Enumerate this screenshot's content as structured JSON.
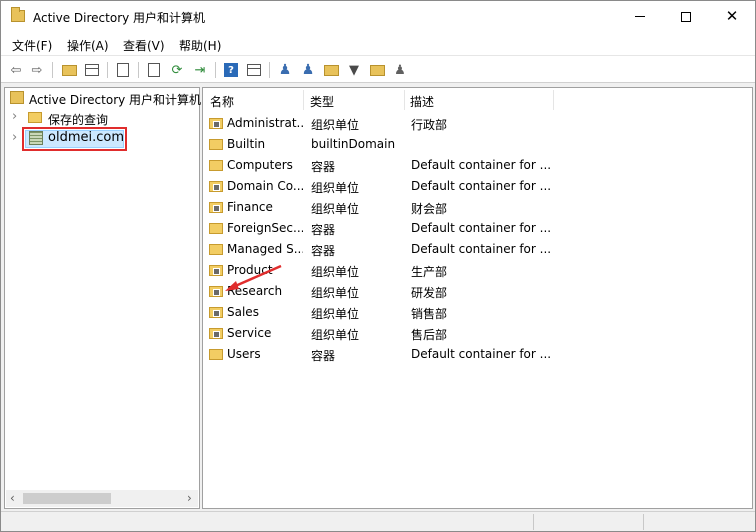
{
  "window": {
    "title": "Active Directory 用户和计算机",
    "controls": {
      "minimize": "minimize",
      "maximize": "maximize",
      "close": "✕"
    }
  },
  "menu": [
    "文件(F)",
    "操作(A)",
    "查看(V)",
    "帮助(H)"
  ],
  "toolbar": {
    "icons": [
      "back-arrow-icon",
      "forward-arrow-icon",
      "up-folder-icon",
      "show-tree-icon",
      "properties-icon",
      "export-list-icon",
      "refresh-icon",
      "export-icon",
      "help-icon",
      "view-icon",
      "new-user-icon",
      "new-group-icon",
      "new-ou-icon",
      "filter-icon",
      "find-icon",
      "delegate-icon"
    ],
    "help_label": "?"
  },
  "tree": {
    "root_label": "Active Directory 用户和计算机",
    "saved_queries_label": "保存的查询",
    "domain_label": "oldmei.com"
  },
  "list": {
    "columns": [
      "名称",
      "类型",
      "描述"
    ],
    "rows": [
      {
        "name": "Administrat...",
        "type": "组织单位",
        "desc": "行政部",
        "icon": "ou"
      },
      {
        "name": "Builtin",
        "type": "builtinDomain",
        "desc": "",
        "icon": "container"
      },
      {
        "name": "Computers",
        "type": "容器",
        "desc": "Default container for ...",
        "icon": "container"
      },
      {
        "name": "Domain Co...",
        "type": "组织单位",
        "desc": "Default container for ...",
        "icon": "ou"
      },
      {
        "name": "Finance",
        "type": "组织单位",
        "desc": "财会部",
        "icon": "ou"
      },
      {
        "name": "ForeignSec...",
        "type": "容器",
        "desc": "Default container for ...",
        "icon": "container"
      },
      {
        "name": "Managed S...",
        "type": "容器",
        "desc": "Default container for ...",
        "icon": "container"
      },
      {
        "name": "Product",
        "type": "组织单位",
        "desc": "生产部",
        "icon": "ou"
      },
      {
        "name": "Research",
        "type": "组织单位",
        "desc": "研发部",
        "icon": "ou"
      },
      {
        "name": "Sales",
        "type": "组织单位",
        "desc": "销售部",
        "icon": "ou"
      },
      {
        "name": "Service",
        "type": "组织单位",
        "desc": "售后部",
        "icon": "ou"
      },
      {
        "name": "Users",
        "type": "容器",
        "desc": "Default container for ...",
        "icon": "container"
      }
    ]
  },
  "colors": {
    "highlight_border": "#e02d2d",
    "arrow": "#e02d2d",
    "selection_bg": "#cce8ff",
    "folder": "#f2cd63"
  }
}
